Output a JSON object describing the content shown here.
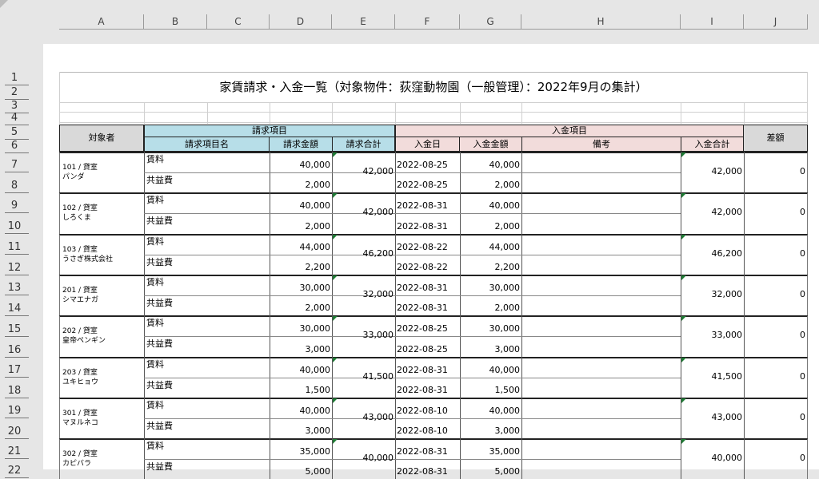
{
  "columns": [
    "A",
    "B",
    "C",
    "D",
    "E",
    "F",
    "G",
    "H",
    "I",
    "J"
  ],
  "rows": [
    "1",
    "2",
    "3",
    "4",
    "5",
    "6",
    "7",
    "8",
    "9",
    "10",
    "11",
    "12",
    "13",
    "14",
    "15",
    "16",
    "17",
    "18",
    "19",
    "20",
    "21",
    "22"
  ],
  "title": "家賃請求・入金一覧（対象物件：荻窪動物園（一般管理）：2022年9月の集計）",
  "headers": {
    "target": "対象者",
    "billing_group": "請求項目",
    "billing_item": "請求項目名",
    "billing_amount": "請求金額",
    "billing_total": "請求合計",
    "payment_group": "入金項目",
    "payment_date": "入金日",
    "payment_amount": "入金金額",
    "note": "備考",
    "payment_total": "入金合計",
    "diff": "差額"
  },
  "records": [
    {
      "unit": "101 / 貸室",
      "name": "パンダ",
      "items": [
        {
          "label": "賃料",
          "amount": "40,000",
          "date": "2022-08-25",
          "paid": "40,000"
        },
        {
          "label": "共益費",
          "amount": "2,000",
          "date": "2022-08-25",
          "paid": "2,000"
        }
      ],
      "bill_total": "42,000",
      "pay_total": "42,000",
      "diff": "0"
    },
    {
      "unit": "102 / 貸室",
      "name": "しろくま",
      "items": [
        {
          "label": "賃料",
          "amount": "40,000",
          "date": "2022-08-31",
          "paid": "40,000"
        },
        {
          "label": "共益費",
          "amount": "2,000",
          "date": "2022-08-31",
          "paid": "2,000"
        }
      ],
      "bill_total": "42,000",
      "pay_total": "42,000",
      "diff": "0"
    },
    {
      "unit": "103 / 貸室",
      "name": "うさぎ株式会社",
      "items": [
        {
          "label": "賃料",
          "amount": "44,000",
          "date": "2022-08-22",
          "paid": "44,000"
        },
        {
          "label": "共益費",
          "amount": "2,200",
          "date": "2022-08-22",
          "paid": "2,200"
        }
      ],
      "bill_total": "46,200",
      "pay_total": "46,200",
      "diff": "0"
    },
    {
      "unit": "201 / 貸室",
      "name": "シマエナガ",
      "items": [
        {
          "label": "賃料",
          "amount": "30,000",
          "date": "2022-08-31",
          "paid": "30,000"
        },
        {
          "label": "共益費",
          "amount": "2,000",
          "date": "2022-08-31",
          "paid": "2,000"
        }
      ],
      "bill_total": "32,000",
      "pay_total": "32,000",
      "diff": "0"
    },
    {
      "unit": "202 / 貸室",
      "name": "皇帝ペンギン",
      "items": [
        {
          "label": "賃料",
          "amount": "30,000",
          "date": "2022-08-25",
          "paid": "30,000"
        },
        {
          "label": "共益費",
          "amount": "3,000",
          "date": "2022-08-25",
          "paid": "3,000"
        }
      ],
      "bill_total": "33,000",
      "pay_total": "33,000",
      "diff": "0"
    },
    {
      "unit": "203 / 貸室",
      "name": "ユキヒョウ",
      "items": [
        {
          "label": "賃料",
          "amount": "40,000",
          "date": "2022-08-31",
          "paid": "40,000"
        },
        {
          "label": "共益費",
          "amount": "1,500",
          "date": "2022-08-31",
          "paid": "1,500"
        }
      ],
      "bill_total": "41,500",
      "pay_total": "41,500",
      "diff": "0"
    },
    {
      "unit": "301 / 貸室",
      "name": "マヌルネコ",
      "items": [
        {
          "label": "賃料",
          "amount": "40,000",
          "date": "2022-08-10",
          "paid": "40,000"
        },
        {
          "label": "共益費",
          "amount": "3,000",
          "date": "2022-08-10",
          "paid": "3,000"
        }
      ],
      "bill_total": "43,000",
      "pay_total": "43,000",
      "diff": "0"
    },
    {
      "unit": "302 / 貸室",
      "name": "カピバラ",
      "items": [
        {
          "label": "賃料",
          "amount": "35,000",
          "date": "2022-08-31",
          "paid": "35,000"
        },
        {
          "label": "共益費",
          "amount": "5,000",
          "date": "2022-08-31",
          "paid": "5,000"
        }
      ],
      "bill_total": "40,000",
      "pay_total": "40,000",
      "diff": "0"
    }
  ]
}
